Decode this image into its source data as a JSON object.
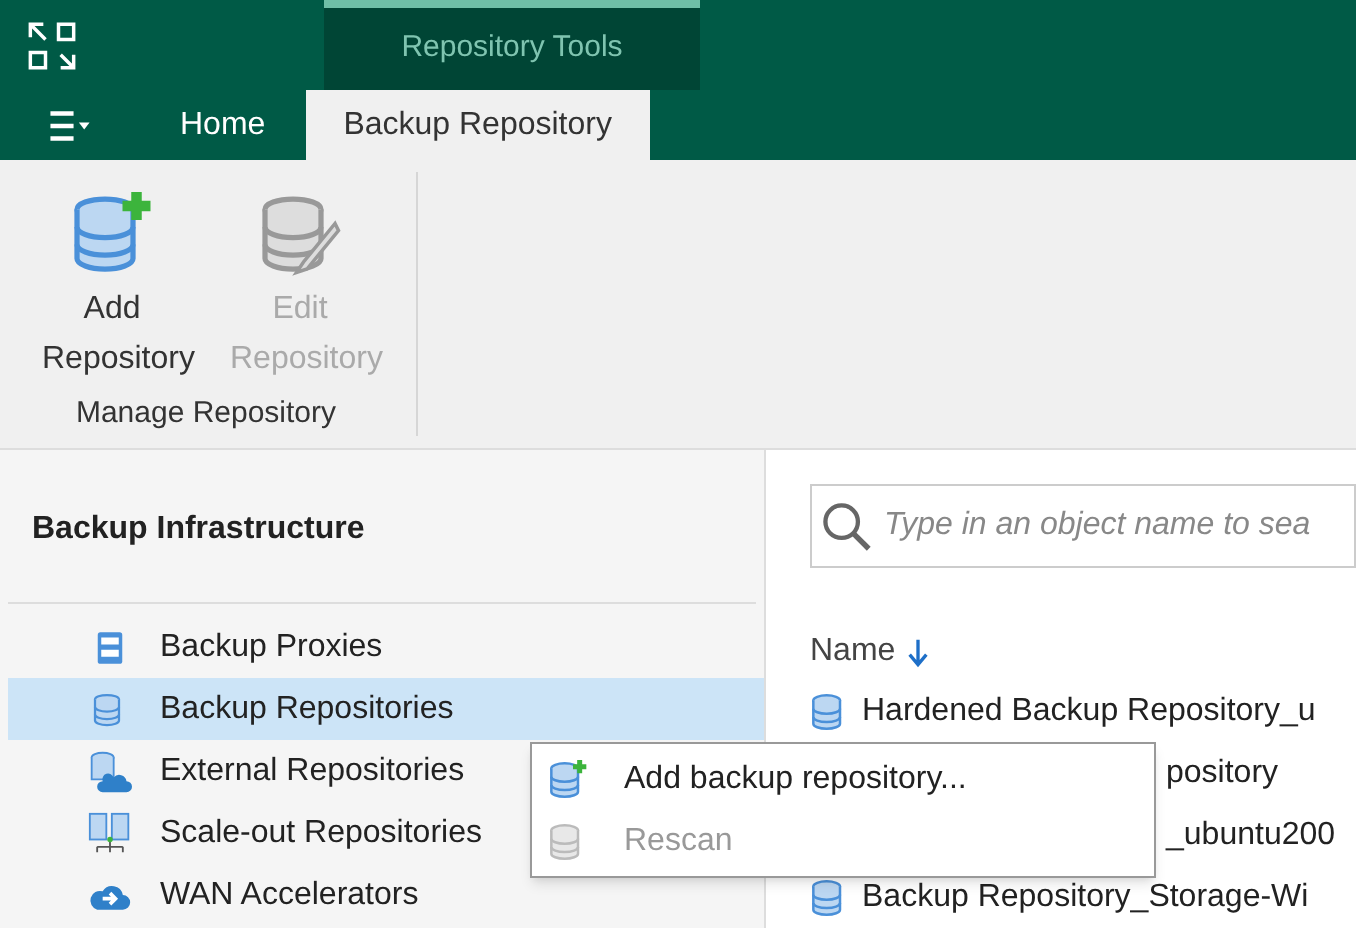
{
  "contextual_group": "Repository Tools",
  "tabs": [
    {
      "label": "Home",
      "selected": false
    },
    {
      "label": "Backup Repository",
      "selected": true
    }
  ],
  "ribbon": {
    "buttons": [
      {
        "kind": "add",
        "label": "Add Repository",
        "disabled": false
      },
      {
        "kind": "edit",
        "label": "Edit Repository",
        "disabled": true
      }
    ],
    "group_label": "Manage Repository"
  },
  "sidebar": {
    "title": "Backup Infrastructure",
    "items": [
      {
        "kind": "proxy",
        "label": "Backup Proxies",
        "selected": false
      },
      {
        "kind": "repo",
        "label": "Backup Repositories",
        "selected": true
      },
      {
        "kind": "external",
        "label": "External Repositories",
        "selected": false
      },
      {
        "kind": "scaleout",
        "label": "Scale-out Repositories",
        "selected": false
      },
      {
        "kind": "wan",
        "label": "WAN Accelerators",
        "selected": false
      }
    ]
  },
  "search": {
    "placeholder": "Type in an object name to sea"
  },
  "table": {
    "column": "Name",
    "rows": [
      {
        "name": "Hardened Backup Repository_u",
        "icon_visible": true
      },
      {
        "name": "pository",
        "icon_visible": false
      },
      {
        "name": "_ubuntu200",
        "icon_visible": false
      },
      {
        "name": "Backup Repository_Storage-Wi",
        "icon_visible": true
      }
    ]
  },
  "context_menu": [
    {
      "kind": "add",
      "label": "Add backup repository...",
      "disabled": false
    },
    {
      "kind": "rescan",
      "label": "Rescan",
      "disabled": true
    }
  ]
}
